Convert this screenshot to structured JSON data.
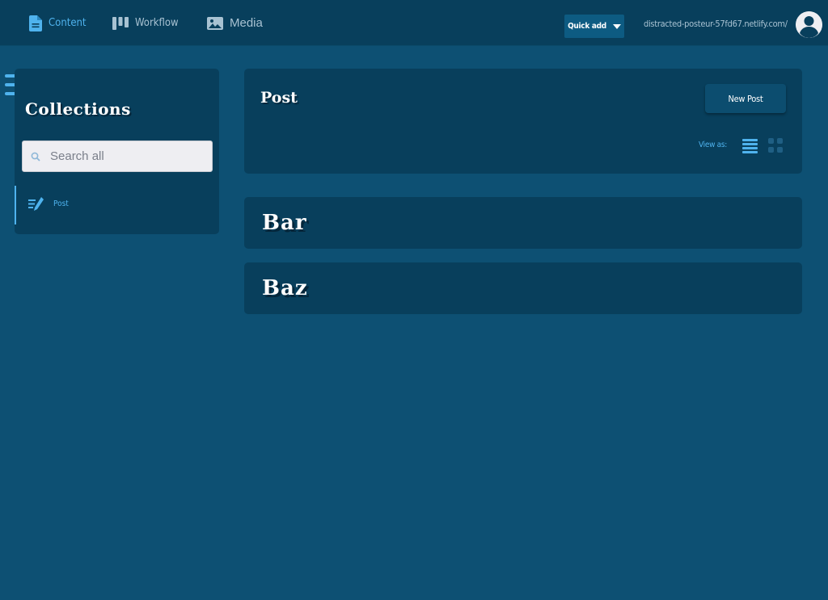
{
  "topbar": {
    "nav": [
      {
        "label": "Content",
        "icon": "document-icon"
      },
      {
        "label": "Workflow",
        "icon": "kanban-icon"
      },
      {
        "label": "Media",
        "icon": "image-icon"
      }
    ],
    "quick_add_label": "Quick add",
    "site_url": "distracted-posteur-57fd67.netlify.com/",
    "avatar_icon": "user-avatar-icon"
  },
  "sidebar": {
    "title": "Collections",
    "search_placeholder": "Search all",
    "collections": [
      {
        "label": "Post",
        "icon": "edit-list-icon",
        "active": true
      }
    ]
  },
  "main": {
    "collection_title": "Post",
    "new_button_label": "New Post",
    "view_as_label": "View as:",
    "view_modes": [
      "list-view-icon",
      "grid-view-icon"
    ],
    "active_view": "list",
    "entries": [
      {
        "title": "Bar"
      },
      {
        "title": "Baz"
      }
    ]
  },
  "colors": {
    "background": "#0d5073",
    "topbar": "#083f5c",
    "card": "#083f5c",
    "accent": "#4fb3ee",
    "muted_text": "#a8c2d2"
  }
}
